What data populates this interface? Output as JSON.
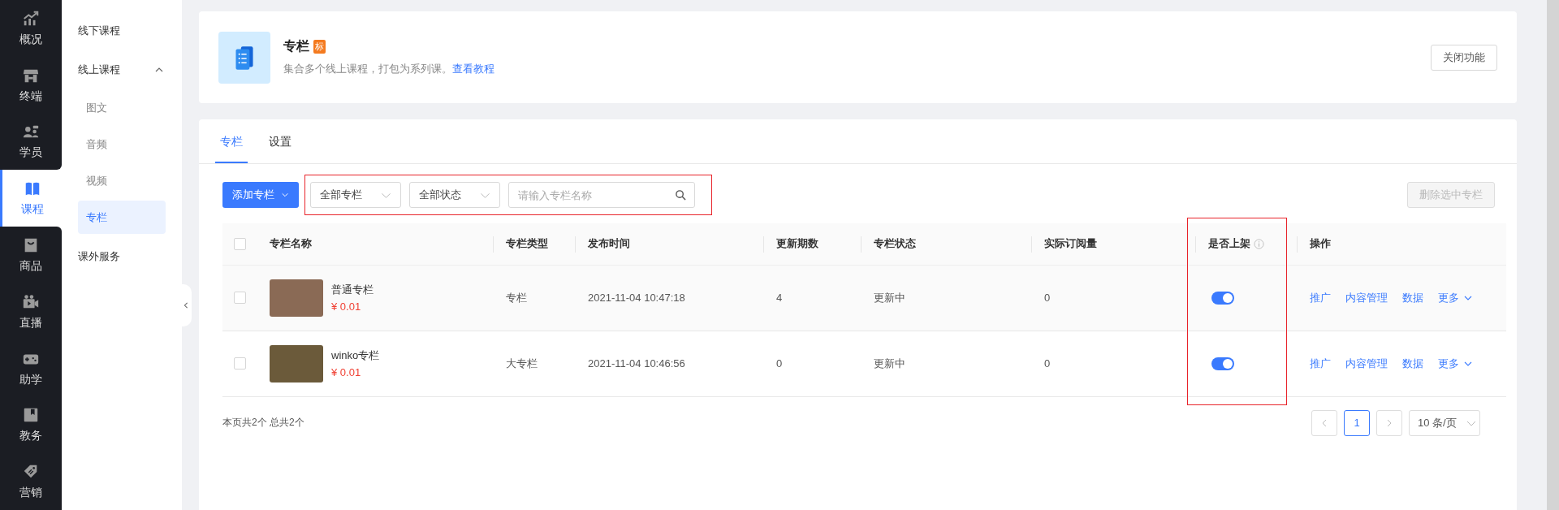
{
  "nav": [
    {
      "label": "概况",
      "selected": false
    },
    {
      "label": "终端",
      "selected": false
    },
    {
      "label": "学员",
      "selected": false
    },
    {
      "label": "课程",
      "selected": true
    },
    {
      "label": "商品",
      "selected": false
    },
    {
      "label": "直播",
      "selected": false
    },
    {
      "label": "助学",
      "selected": false
    },
    {
      "label": "教务",
      "selected": false
    },
    {
      "label": "营销",
      "selected": false
    }
  ],
  "subnav": [
    {
      "label": "线下课程"
    },
    {
      "label": "线上课程",
      "expanded": true,
      "children": [
        {
          "label": "图文",
          "selected": false
        },
        {
          "label": "音频",
          "selected": false
        },
        {
          "label": "视频",
          "selected": false
        },
        {
          "label": "专栏",
          "selected": true
        }
      ]
    },
    {
      "label": "课外服务"
    }
  ],
  "header": {
    "title": "专栏",
    "badge": "标",
    "description": "集合多个线上课程，打包为系列课。",
    "link": "查看教程",
    "button": "关闭功能"
  },
  "tabs": [
    {
      "label": "专栏",
      "selected": true
    },
    {
      "label": "设置",
      "selected": false
    }
  ],
  "toolbar": {
    "add_button": "添加专栏",
    "filters": [
      {
        "value": "全部专栏"
      },
      {
        "value": "全部状态"
      }
    ],
    "search": {
      "placeholder": "请输入专栏名称"
    },
    "delete_button": {
      "label": "删除选中专栏",
      "disabled": true
    }
  },
  "table": {
    "select_all_checked": false,
    "columns": [
      {
        "label": "专栏名称",
        "info": false
      },
      {
        "label": "专栏类型",
        "info": false
      },
      {
        "label": "发布时间",
        "info": false
      },
      {
        "label": "更新期数",
        "info": false
      },
      {
        "label": "专栏状态",
        "info": false
      },
      {
        "label": "实际订阅量",
        "info": false
      },
      {
        "label": "是否上架",
        "info": true
      },
      {
        "label": "操作",
        "info": false
      }
    ],
    "rows": [
      {
        "checked": false,
        "name": "普通专栏",
        "price": "¥ 0.01",
        "type": "专栏",
        "time": "2021-11-04 10:47:18",
        "updates": "4",
        "status": "更新中",
        "subscriptions": "0",
        "listed": true,
        "actions": [
          {
            "label": "推广",
            "dropdown": false
          },
          {
            "label": "内容管理",
            "dropdown": false
          },
          {
            "label": "数据",
            "dropdown": false
          },
          {
            "label": "更多",
            "dropdown": true
          }
        ]
      },
      {
        "checked": false,
        "name": "winko专栏",
        "price": "¥ 0.01",
        "type": "大专栏",
        "time": "2021-11-04 10:46:56",
        "updates": "0",
        "status": "更新中",
        "subscriptions": "0",
        "listed": true,
        "actions": [
          {
            "label": "推广",
            "dropdown": false
          },
          {
            "label": "内容管理",
            "dropdown": false
          },
          {
            "label": "数据",
            "dropdown": false
          },
          {
            "label": "更多",
            "dropdown": true
          }
        ]
      }
    ]
  },
  "footer": {
    "summary": "本页共2个 总共2个",
    "pages": [
      {
        "label": "1",
        "selected": true
      }
    ],
    "page_size": "10 条/页"
  },
  "highlights": {
    "filters": true,
    "listed_column": true
  }
}
